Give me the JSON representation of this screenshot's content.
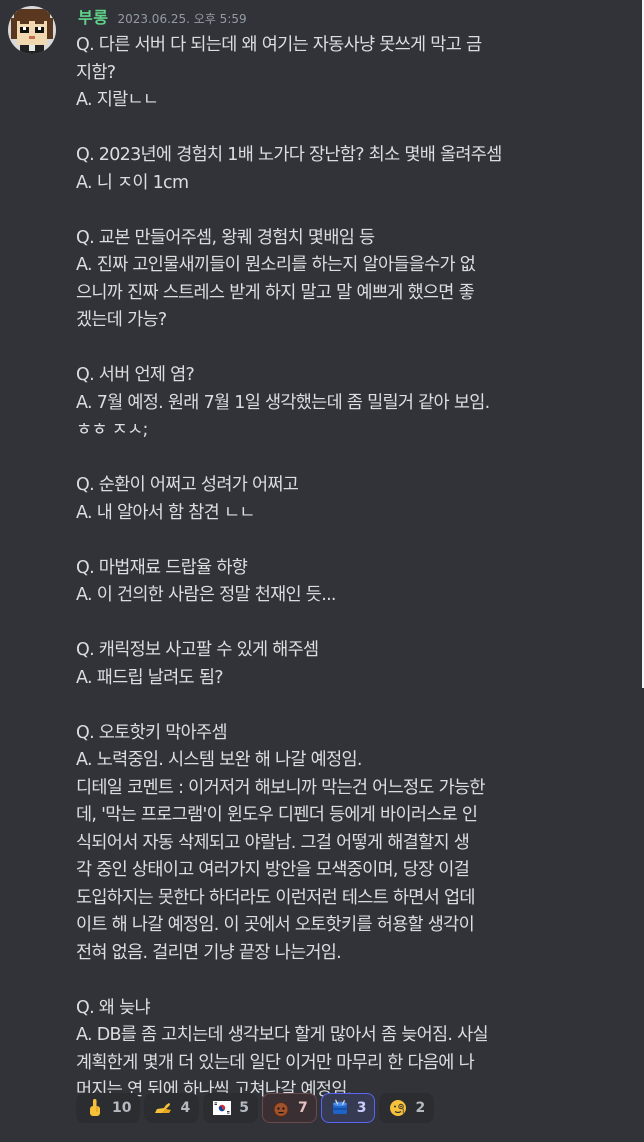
{
  "message": {
    "author": "부롱",
    "timestamp": "2023.06.25. 오후 5:59",
    "author_color": "#5fd48a",
    "lines": [
      "Q. 다른 서버 다 되는데 왜 여기는 자동사냥 못쓰게 막고 금",
      "지함?",
      "A. 지랄ㄴㄴ",
      "",
      "Q. 2023년에 경험치 1배 노가다 장난함? 최소 몇배 올려주셈",
      "A. 니 ㅈ이 1cm",
      "",
      "Q. 교본 만들어주셈, 왕퀘 경험치 몇배임 등",
      "A. 진짜 고인물새끼들이 뭔소리를 하는지 알아들을수가 없",
      "으니까 진짜 스트레스 받게 하지 말고 말 예쁘게 했으면 좋",
      "겠는데 가능?",
      "",
      "Q. 서버 언제 염?",
      "A. 7월 예정. 원래 7월 1일 생각했는데 좀 밀릴거 같아 보임.",
      "ㅎㅎ ㅈㅅ;",
      "",
      "Q. 순환이 어쩌고 성려가 어쩌고",
      "A. 내 알아서 함 참견 ㄴㄴ",
      "",
      "Q. 마법재료 드랍율 하향",
      "A. 이 건의한 사람은 정말 천재인 듯...",
      "",
      "Q. 캐릭정보 사고팔 수 있게 해주셈",
      "A. 패드립 날려도 됨?",
      "",
      "Q. 오토핫키 막아주셈",
      "A. 노력중임. 시스템 보완 해 나갈 예정임.",
      "디테일 코멘트 : 이거저거 해보니까 막는건 어느정도 가능한",
      "데, '막는 프로그램'이 윈도우 디펜더 등에게 바이러스로 인",
      "식되어서 자동 삭제되고 야랄남. 그걸 어떻게 해결할지 생",
      "각 중인 상태이고 여러가지 방안을 모색중이며, 당장 이걸",
      "도입하지는 못한다 하더라도 이런저런 테스트 하면서 업데",
      "이트 해 나갈 예정임. 이 곳에서 오토핫키를 허용할 생각이",
      "전혀 없음. 걸리면 기냥 끝장 나는거임.",
      "",
      "Q. 왜 늦냐",
      "A. DB를 좀 고치는데 생각보다 할게 많아서 좀 늦어짐. 사실",
      "계획한게 몇개 더 있는데 일단 이거만 마무리 한 다음에 나",
      "머지는 연 뒤에 하나씩 고쳐나갈 예정임."
    ]
  },
  "reactions": [
    {
      "icon": "pointing-finger-icon",
      "count": "10",
      "active": false
    },
    {
      "icon": "flexed-arm-icon",
      "count": "4",
      "active": false
    },
    {
      "icon": "korea-flag-icon",
      "count": "5",
      "active": false
    },
    {
      "icon": "bomb-face-icon",
      "count": "7",
      "active": "red"
    },
    {
      "icon": "blue-drum-icon",
      "count": "3",
      "active": "blue"
    },
    {
      "icon": "face-with-monocle-icon",
      "count": "2",
      "active": false
    }
  ]
}
